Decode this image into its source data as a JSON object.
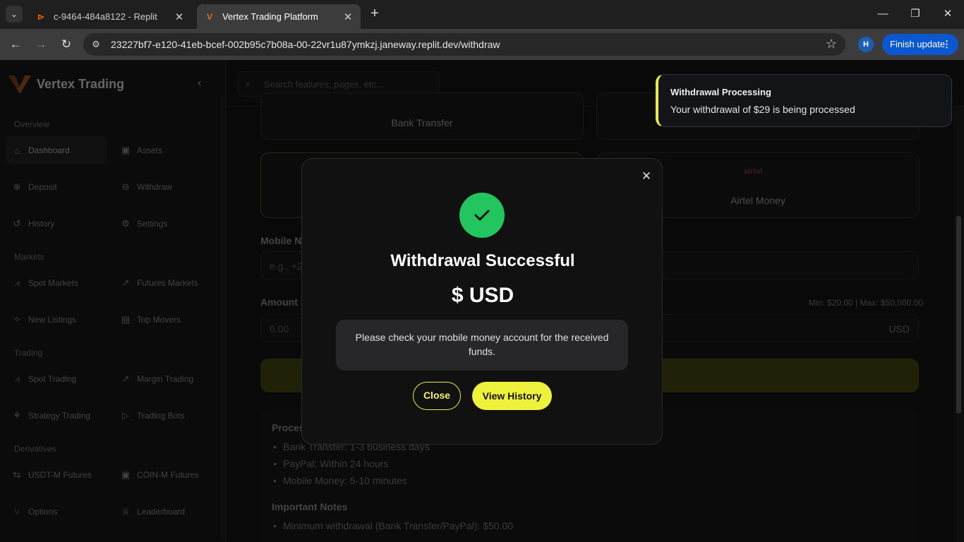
{
  "browser": {
    "tabs": [
      {
        "title": "c-9464-484a8122 - Replit",
        "active": false
      },
      {
        "title": "Vertex Trading Platform",
        "active": true
      }
    ],
    "url": "23227bf7-e120-41eb-bcef-002b95c7b08a-00-22vr1u87ymkzj.janeway.replit.dev/withdraw",
    "profile_initial": "H",
    "update_label": "Finish update"
  },
  "sidebar": {
    "brand": "Vertex Trading",
    "sections": [
      {
        "title": "Overview",
        "items": [
          "Dashboard",
          "Assets",
          "Deposit",
          "Withdraw",
          "History",
          "Settings"
        ]
      },
      {
        "title": "Markets",
        "items": [
          "Spot Markets",
          "Futures Markets",
          "New Listings",
          "Top Movers"
        ]
      },
      {
        "title": "Trading",
        "items": [
          "Spot Trading",
          "Margin Trading",
          "Strategy Trading",
          "Trading Bots"
        ]
      },
      {
        "title": "Derivatives",
        "items": [
          "USDT-M Futures",
          "COIN-M Futures",
          "Options",
          "Leaderboard"
        ]
      }
    ]
  },
  "search": {
    "placeholder": "Search features, pages, etc..."
  },
  "withdraw": {
    "method_bank": "Bank Transfer",
    "method_airtel_logo": "airtel",
    "method_airtel": "Airtel Money",
    "mobile_label": "Mobile N",
    "mobile_placeholder": "e.g., +2",
    "amount_label": "Amount",
    "amount_placeholder": "0.00",
    "amount_limits": "Min: $20.00 | Max: $50,000.00",
    "currency": "USD",
    "processing_title": "Proces",
    "processing_items": [
      "Bank Transfer: 1-3 business days",
      "PayPal: Within 24 hours",
      "Mobile Money: 5-10 minutes"
    ],
    "notes_title": "Important Notes",
    "notes_items": [
      "Minimum withdrawal (Bank Transfer/PayPal): $50.00"
    ]
  },
  "modal": {
    "title": "Withdrawal Successful",
    "amount": "$ USD",
    "message": "Please check your mobile money account for the received funds.",
    "close_label": "Close",
    "history_label": "View History"
  },
  "toast": {
    "title": "Withdrawal Processing",
    "message": "Your withdrawal of $29 is being processed"
  },
  "colors": {
    "accent": "#eef23a",
    "success": "#22c55e",
    "brand": "#e4682a"
  }
}
